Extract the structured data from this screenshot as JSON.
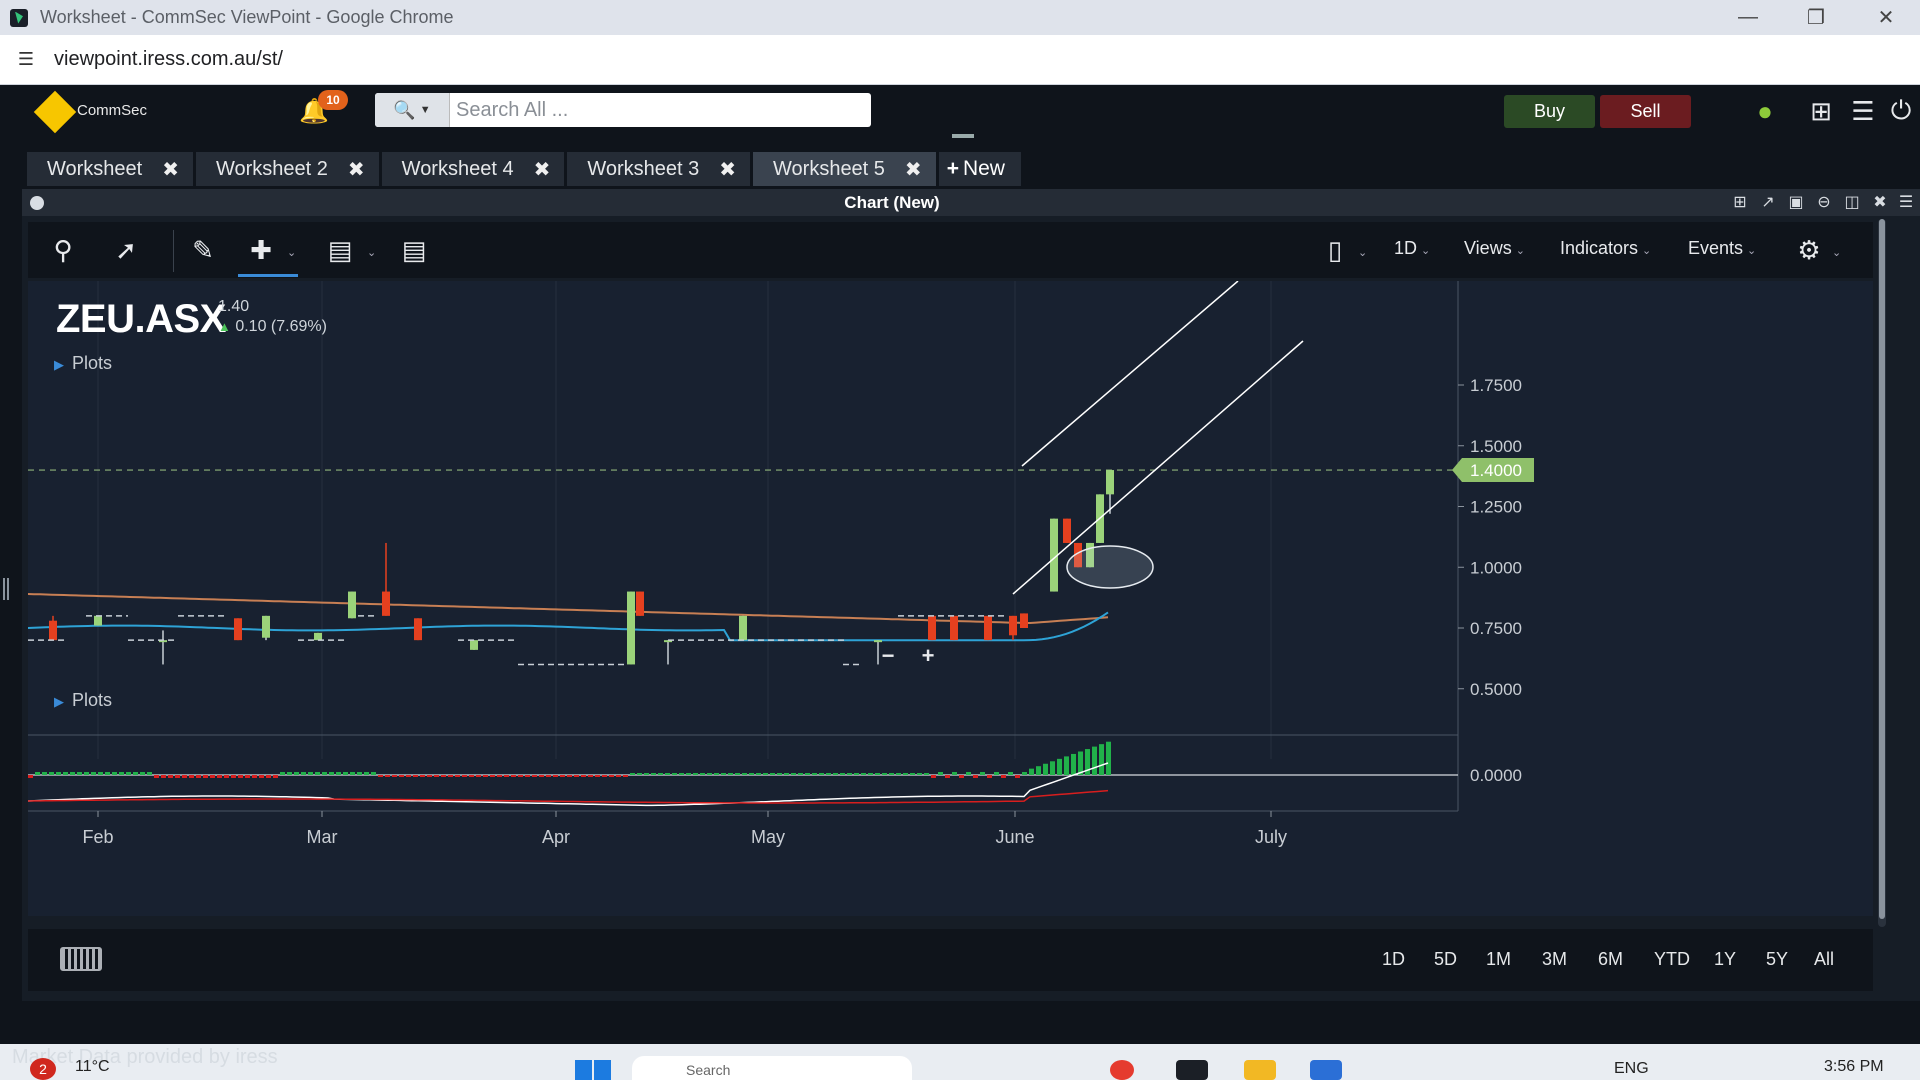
{
  "window": {
    "title": "Worksheet - CommSec ViewPoint - Google Chrome",
    "url": "viewpoint.iress.com.au/st/"
  },
  "header": {
    "logo_text": "CommSec",
    "notification_count": "10",
    "search_placeholder": "Search All ...",
    "buy_label": "Buy",
    "sell_label": "Sell"
  },
  "tabs": [
    {
      "label": "Worksheet"
    },
    {
      "label": "Worksheet 2"
    },
    {
      "label": "Worksheet 4"
    },
    {
      "label": "Worksheet 3"
    },
    {
      "label": "Worksheet 5",
      "active": true
    }
  ],
  "new_tab_label": "New",
  "panel": {
    "title": "Chart (New)"
  },
  "toolbar": {
    "interval": "1D",
    "views": "Views",
    "indicators": "Indicators",
    "events": "Events"
  },
  "quote": {
    "symbol": "ZEU.ASX",
    "last": "1.40",
    "change": "0.10 (7.69%)",
    "price_tag": "1.4000"
  },
  "plots_label": "Plots",
  "zoom": {
    "minus": "−",
    "plus": "+"
  },
  "chart_data": {
    "type": "candlestick",
    "y_axis_labels": [
      "1.7500",
      "1.5000",
      "1.2500",
      "1.0000",
      "0.7500",
      "0.5000"
    ],
    "ylim": [
      0.4,
      1.9
    ],
    "x_axis_labels": [
      "Feb",
      "Mar",
      "Apr",
      "May",
      "June",
      "July"
    ],
    "last_price": 1.4,
    "indicator_axis_label": "0.0000",
    "colors": {
      "up": "#9bd37a",
      "down": "#e5401f",
      "ma_long": "#c77f54",
      "ma_short": "#2ea3d6",
      "hist_up": "#21b14a",
      "hist_down": "#d81e1e",
      "macd": "#ffffff",
      "signal": "#d81e1e"
    }
  },
  "ranges": [
    "1D",
    "5D",
    "1M",
    "3M",
    "6M",
    "YTD",
    "1Y",
    "5Y",
    "All"
  ],
  "footer_note": "Market Data provided by iress",
  "taskbar": {
    "weather_alert": "2",
    "temperature": "11°C",
    "search": "Search",
    "language": "ENG",
    "time": "3:56 PM"
  }
}
